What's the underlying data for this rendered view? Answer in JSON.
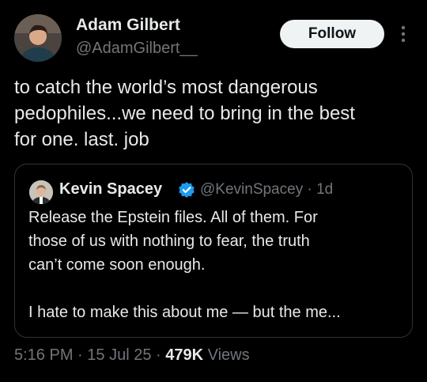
{
  "tweet": {
    "author": {
      "name": "Adam Gilbert",
      "handle": "@AdamGilbert__"
    },
    "follow_label": "Follow",
    "text_lines": [
      "to catch the world’s most dangerous",
      "pedophiles...we need to bring in the best",
      "for one. last. job"
    ],
    "quoted": {
      "name": "Kevin Spacey",
      "handle_and_time": "@KevinSpacey · 1d",
      "text_lines": [
        "Release the Epstein files. All of them. For",
        "those of us with nothing to fear, the truth",
        "can’t come soon enough.",
        "",
        "I hate to make this about me — but the me..."
      ]
    },
    "meta": {
      "time": "5:16 PM",
      "sep1": " · ",
      "date": "15 Jul 25",
      "sep2": " · ",
      "views_count": "479K",
      "views_label": " Views"
    }
  },
  "colors": {
    "background": "#000000",
    "primary_text": "#e7e9ea",
    "secondary_text": "#71767b",
    "border": "#2f3336",
    "verified": "#1d9bf0",
    "follow_bg": "#eff3f4"
  },
  "icons": {
    "more": "more-vertical-icon",
    "verified": "verified-badge-icon"
  }
}
